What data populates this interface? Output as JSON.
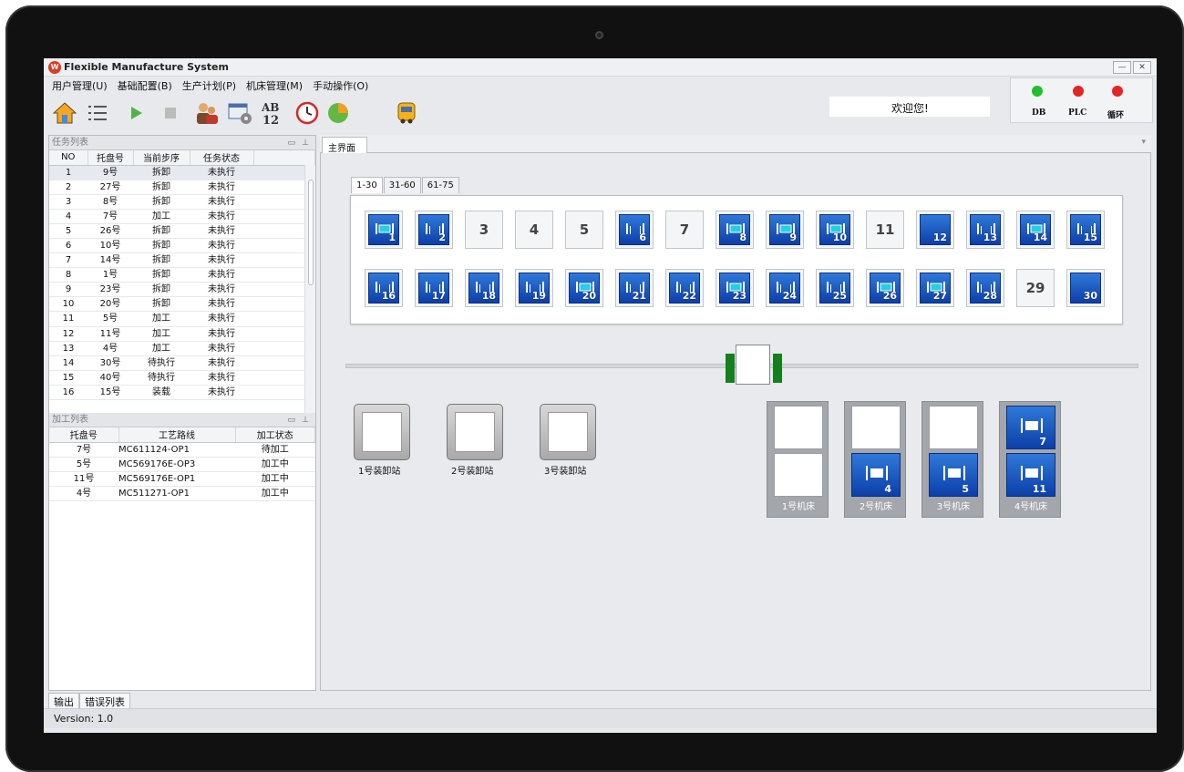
{
  "window": {
    "title": "Flexible Manufacture System",
    "app_icon_text": "W"
  },
  "menu": [
    "用户管理(U)",
    "基础配置(B)",
    "生产计划(P)",
    "机床管理(M)",
    "手动操作(O)"
  ],
  "welcome": "欢迎您!",
  "status_lights": [
    {
      "label": "DB",
      "color": "#1fbf2f"
    },
    {
      "label": "PLC",
      "color": "#e52424"
    },
    {
      "label": "循环",
      "color": "#e52424"
    }
  ],
  "task_panel": {
    "title": "任务列表",
    "columns": [
      "NO",
      "托盘号",
      "当前步序",
      "任务状态"
    ],
    "rows": [
      [
        "1",
        "9号",
        "拆卸",
        "未执行"
      ],
      [
        "2",
        "27号",
        "拆卸",
        "未执行"
      ],
      [
        "3",
        "8号",
        "拆卸",
        "未执行"
      ],
      [
        "4",
        "7号",
        "加工",
        "未执行"
      ],
      [
        "5",
        "26号",
        "拆卸",
        "未执行"
      ],
      [
        "6",
        "10号",
        "拆卸",
        "未执行"
      ],
      [
        "7",
        "14号",
        "拆卸",
        "未执行"
      ],
      [
        "8",
        "1号",
        "拆卸",
        "未执行"
      ],
      [
        "9",
        "23号",
        "拆卸",
        "未执行"
      ],
      [
        "10",
        "20号",
        "拆卸",
        "未执行"
      ],
      [
        "11",
        "5号",
        "加工",
        "未执行"
      ],
      [
        "12",
        "11号",
        "加工",
        "未执行"
      ],
      [
        "13",
        "4号",
        "加工",
        "未执行"
      ],
      [
        "14",
        "30号",
        "待执行",
        "未执行"
      ],
      [
        "15",
        "40号",
        "待执行",
        "未执行"
      ],
      [
        "16",
        "15号",
        "装载",
        "未执行"
      ]
    ]
  },
  "process_panel": {
    "title": "加工列表",
    "columns": [
      "托盘号",
      "工艺路线",
      "加工状态"
    ],
    "rows": [
      [
        "7号",
        "MC611124-OP1",
        "待加工"
      ],
      [
        "5号",
        "MC569176E-OP3",
        "加工中"
      ],
      [
        "11号",
        "MC569176E-OP1",
        "加工中"
      ],
      [
        "4号",
        "MC511271-OP1",
        "加工中"
      ]
    ]
  },
  "bottom_tabs": [
    "输出",
    "错误列表"
  ],
  "version": "Version: 1.0",
  "main_tab": "主界面",
  "pallet_tabs": [
    "1-30",
    "31-60",
    "61-75"
  ],
  "pallets": [
    {
      "n": "1",
      "s": "part"
    },
    {
      "n": "2",
      "s": "fixture"
    },
    {
      "n": "3",
      "s": "empty"
    },
    {
      "n": "4",
      "s": "empty"
    },
    {
      "n": "5",
      "s": "empty"
    },
    {
      "n": "6",
      "s": "fixture"
    },
    {
      "n": "7",
      "s": "empty"
    },
    {
      "n": "8",
      "s": "part"
    },
    {
      "n": "9",
      "s": "part"
    },
    {
      "n": "10",
      "s": "part"
    },
    {
      "n": "11",
      "s": "empty"
    },
    {
      "n": "12",
      "s": "blank"
    },
    {
      "n": "13",
      "s": "fixture"
    },
    {
      "n": "14",
      "s": "part"
    },
    {
      "n": "15",
      "s": "fixture"
    },
    {
      "n": "16",
      "s": "fixture"
    },
    {
      "n": "17",
      "s": "fixture"
    },
    {
      "n": "18",
      "s": "fixture"
    },
    {
      "n": "19",
      "s": "fixture"
    },
    {
      "n": "20",
      "s": "part"
    },
    {
      "n": "21",
      "s": "fixture"
    },
    {
      "n": "22",
      "s": "fixture"
    },
    {
      "n": "23",
      "s": "part"
    },
    {
      "n": "24",
      "s": "fixture"
    },
    {
      "n": "25",
      "s": "fixture"
    },
    {
      "n": "26",
      "s": "part"
    },
    {
      "n": "27",
      "s": "part"
    },
    {
      "n": "28",
      "s": "fixture"
    },
    {
      "n": "29",
      "s": "empty"
    },
    {
      "n": "30",
      "s": "blank"
    }
  ],
  "stations": [
    "1号装卸站",
    "2号装卸站",
    "3号装卸站"
  ],
  "machines": [
    {
      "label": "1号机床",
      "top": "",
      "bottom": ""
    },
    {
      "label": "2号机床",
      "top": "",
      "bottom": "4"
    },
    {
      "label": "3号机床",
      "top": "",
      "bottom": "5"
    },
    {
      "label": "4号机床",
      "top": "7",
      "bottom": "11"
    }
  ]
}
